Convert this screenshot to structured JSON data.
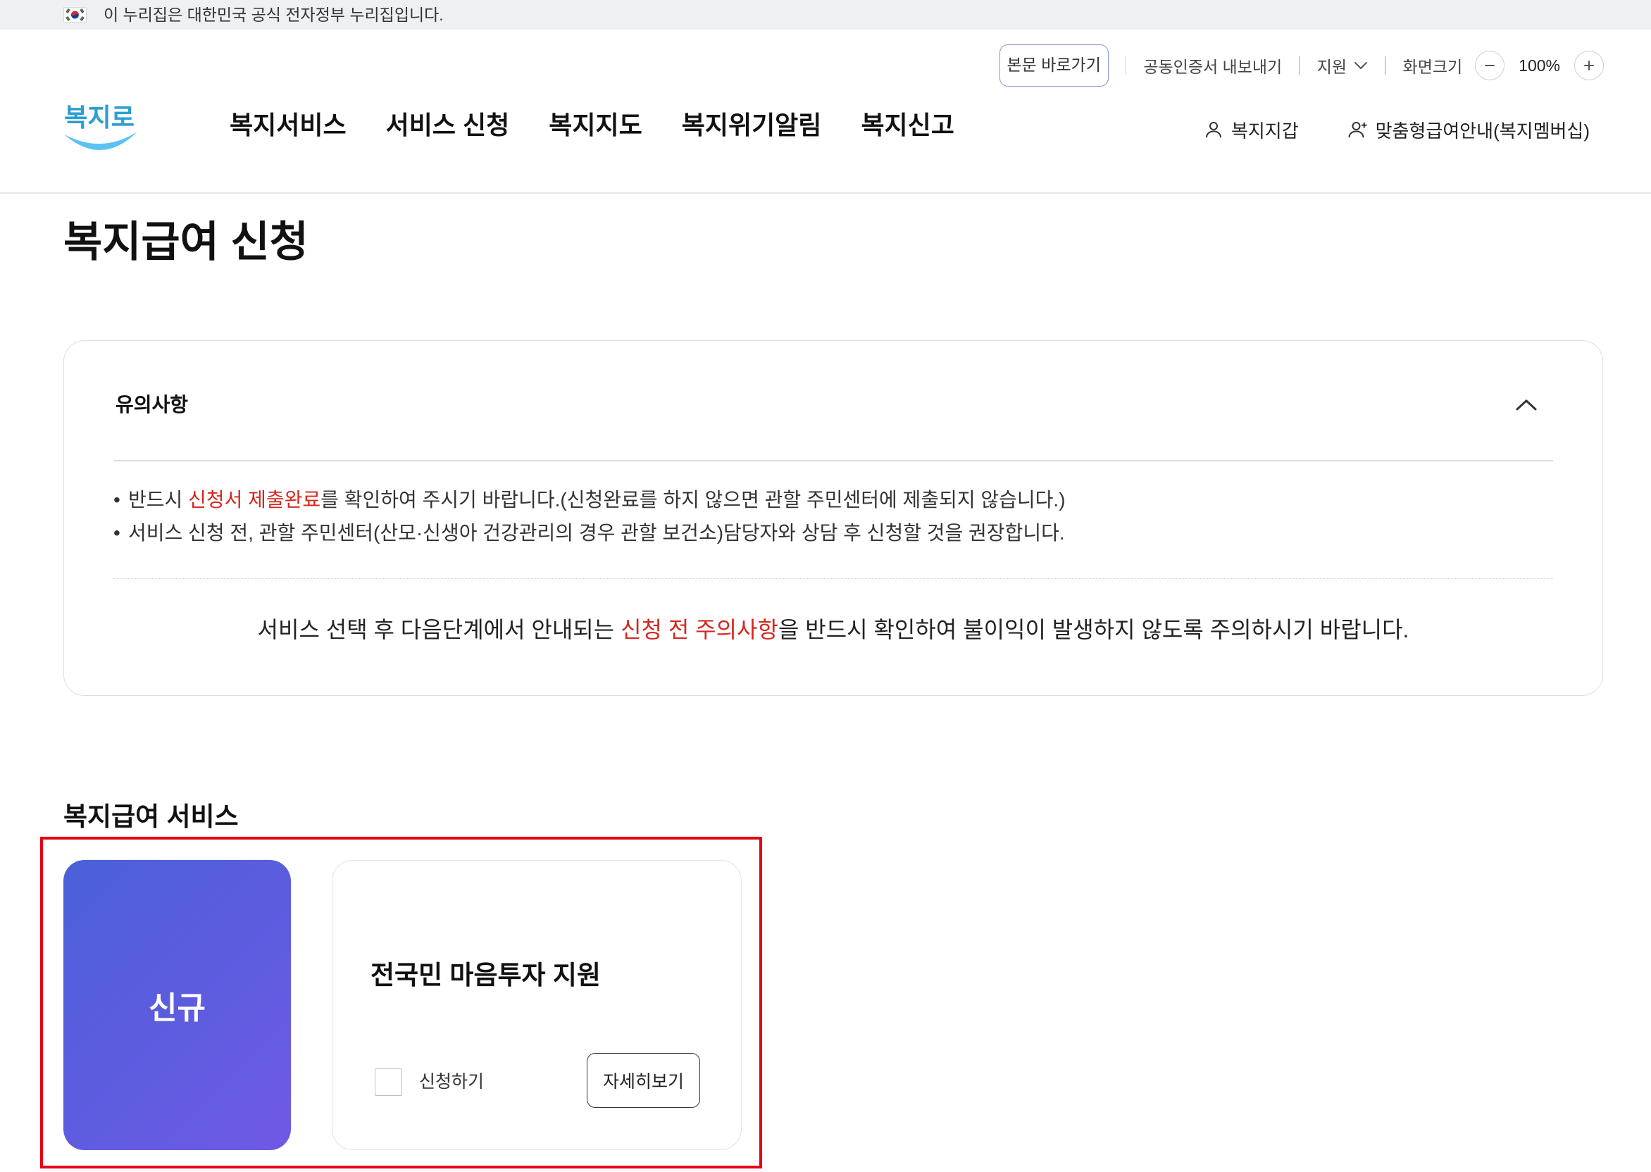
{
  "gov_banner": {
    "text": "이 누리집은 대한민국 공식 전자정부 누리집입니다.",
    "icon": "korea-flag-icon"
  },
  "utility": {
    "skip_to_content": "본문 바로가기",
    "certificate_export": "공동인증서 내보내기",
    "support": "지원",
    "support_icon": "chevron-down-icon",
    "zoom_label": "화면크기",
    "zoom_out_icon": "minus-icon",
    "zoom_value": "100%",
    "zoom_in_icon": "plus-icon"
  },
  "logo": {
    "text": "복지로"
  },
  "nav": {
    "items": [
      "복지서비스",
      "서비스 신청",
      "복지지도",
      "복지위기알림",
      "복지신고"
    ]
  },
  "user_nav": {
    "wallet": {
      "label": "복지지갑",
      "icon": "user-icon"
    },
    "membership": {
      "label": "맞춤형급여안내(복지멤버십)",
      "icon": "user-plus-icon"
    }
  },
  "page": {
    "title": "복지급여 신청"
  },
  "notice": {
    "title": "유의사항",
    "toggle_icon": "chevron-up-icon",
    "expanded": true,
    "bullets": [
      {
        "before": "반드시 ",
        "highlight": "신청서 제출완료",
        "after": "를 확인하여 주시기 바랍니다.(신청완료를 하지 않으면 관할 주민센터에 제출되지 않습니다.)"
      },
      {
        "text": "서비스 신청 전, 관할 주민센터(산모·신생아 건강관리의 경우 관할 보건소)담당자와 상담 후 신청할 것을 권장합니다."
      }
    ],
    "footer": {
      "before": "서비스 선택 후 다음단계에서 안내되는 ",
      "highlight": "신청 전 주의사항",
      "after": "을 반드시 확인하여 불이익이 발생하지 않도록 주의하시기 바랍니다."
    }
  },
  "services": {
    "heading": "복지급여 서비스",
    "items": [
      {
        "badge": "신규",
        "title": "전국민 마음투자 지원",
        "apply_label": "신청하기",
        "apply_checked": false,
        "details_label": "자세히보기"
      }
    ]
  },
  "colors": {
    "accent_red": "#d4271f",
    "badge_gradient_start": "#4a60d8",
    "badge_gradient_end": "#6f59e6",
    "skip_link_border": "#8796d6",
    "highlight_border": "#e60012",
    "logo_text": "#2b9fd0",
    "logo_smile": "#5ac3f2"
  }
}
